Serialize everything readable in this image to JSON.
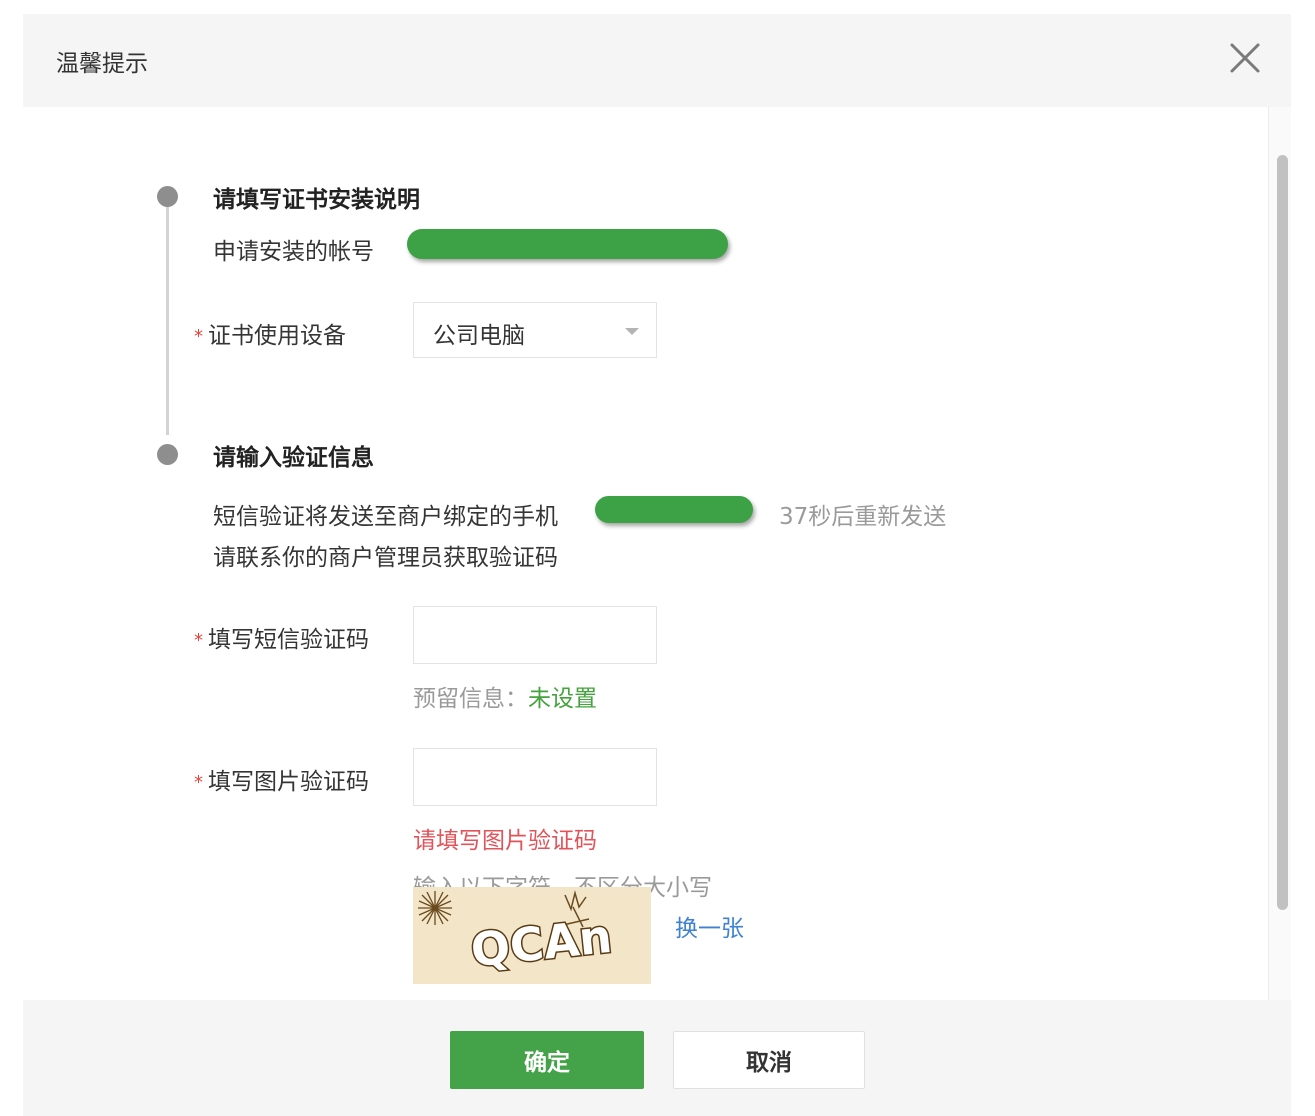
{
  "dialog": {
    "title": "温馨提示"
  },
  "step1": {
    "title": "请填写证书安装说明",
    "account_label": "申请安装的帐号",
    "device_label": "证书使用设备",
    "device_value": "公司电脑"
  },
  "step2": {
    "title": "请输入验证信息",
    "sms_notice": "短信验证将发送至商户绑定的手机",
    "resend_countdown": "37秒后重新发送",
    "contact_notice": "请联系你的商户管理员获取验证码",
    "sms_code_label": "填写短信验证码",
    "sms_code_value": "",
    "reserved_info_label": "预留信息：",
    "reserved_info_value": "未设置",
    "image_code_label": "填写图片验证码",
    "image_code_value": "",
    "image_code_error": "请填写图片验证码",
    "image_code_hint": "输入以下字符，不区分大小写",
    "captcha_text": "QCAn",
    "refresh_captcha_label": "换一张"
  },
  "required_mark": "*",
  "buttons": {
    "confirm": "确定",
    "cancel": "取消"
  },
  "colors": {
    "primary": "#44a248",
    "required": "#e64340",
    "error": "#e0545a",
    "link": "#3f82d3",
    "success_text": "#44a33d",
    "mask": "#3da145"
  },
  "icons": {
    "close": "close-icon",
    "dropdown": "caret-down-icon"
  }
}
